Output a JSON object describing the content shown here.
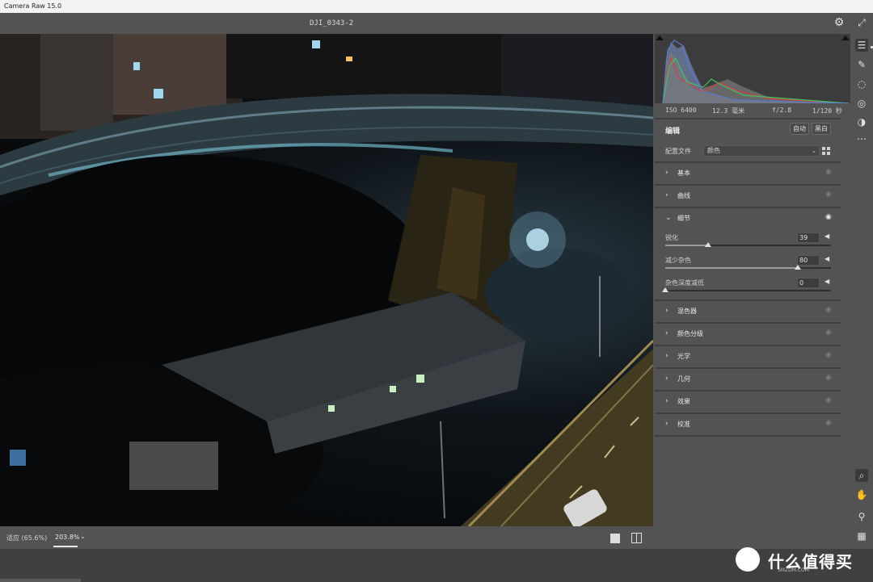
{
  "window": {
    "title": "Camera Raw 15.0"
  },
  "header": {
    "filename": "DJI_0343-2",
    "settings_icon": "gear-icon",
    "fullscreen_icon": "expand-icon"
  },
  "histogram": {
    "exif": {
      "iso": "ISO 6400",
      "focal": "12.3 毫米",
      "aperture": "f/2.8",
      "shutter": "1/120 秒"
    }
  },
  "edit": {
    "title": "编辑",
    "auto_label": "自动",
    "bw_label": "黑白",
    "profile_label": "配置文件",
    "profile_value": "颜色",
    "sections": [
      {
        "label": "基本",
        "expanded": false
      },
      {
        "label": "曲线",
        "expanded": false
      },
      {
        "label": "细节",
        "expanded": true
      },
      {
        "label": "混色器",
        "expanded": false
      },
      {
        "label": "颜色分级",
        "expanded": false
      },
      {
        "label": "光学",
        "expanded": false
      },
      {
        "label": "几何",
        "expanded": false
      },
      {
        "label": "效果",
        "expanded": false
      },
      {
        "label": "校准",
        "expanded": false
      }
    ],
    "detail": {
      "sliders": [
        {
          "label": "锐化",
          "value": "39",
          "fraction": 0.26
        },
        {
          "label": "减少杂色",
          "value": "80",
          "fraction": 0.8
        },
        {
          "label": "杂色深度减低",
          "value": "0",
          "fraction": 0.0
        }
      ]
    }
  },
  "bottom": {
    "fit_label": "适应 (65.6%)",
    "zoom_label": "203.8%"
  },
  "tools": [
    "edit-sliders-icon",
    "healing-brush-icon",
    "masking-icon",
    "red-eye-icon",
    "presets-icon",
    "more-icon",
    "zoom-icon",
    "hand-icon",
    "eyedropper-icon",
    "grid-icon"
  ],
  "watermark": {
    "text": "什么值得买",
    "sub": "SMZDM.COM"
  }
}
